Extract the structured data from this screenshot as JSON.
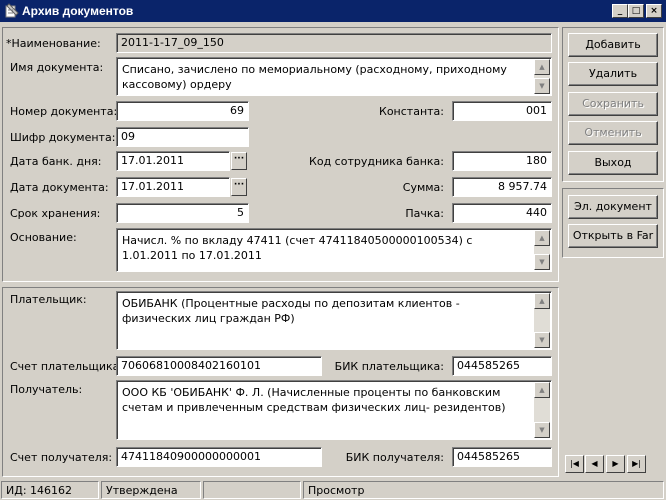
{
  "window": {
    "title": "Архив документов",
    "minimize": "_",
    "maximize": "□",
    "close": "×"
  },
  "document": {
    "name_label": "*Наименование:",
    "name_value": "2011-1-17_09_150",
    "docname_label": "Имя документа:",
    "docname_value": "Списано, зачислено по мемориальному (расходному, приходному кассовому) ордеру",
    "number_label": "Номер документа:",
    "number_value": "69",
    "constant_label": "Константа:",
    "constant_value": "001",
    "cipher_label": "Шифр документа:",
    "cipher_value": "09",
    "bankday_label": "Дата банк. дня:",
    "bankday_value": "17.01.2011",
    "employee_label": "Код сотрудника банка:",
    "employee_value": "180",
    "docdate_label": "Дата документа:",
    "docdate_value": "17.01.2011",
    "sum_label": "Сумма:",
    "sum_value": "8 957.74",
    "storage_label": "Срок хранения:",
    "storage_value": "5",
    "pack_label": "Пачка:",
    "pack_value": "440",
    "basis_label": "Основание:",
    "basis_value": "Начисл. % по вкладу 47411 (счет 47411840500000100534) с  1.01.2011 по 17.01.2011"
  },
  "parties": {
    "payer_label": "Плательщик:",
    "payer_value": "ОБИБАНК (Процентные расходы по депозитам клиентов - физических лиц граждан РФ)",
    "payer_account_label": "Счет плательщика:",
    "payer_account_value": "70606810008402160101",
    "payer_bik_label": "БИК плательщика:",
    "payer_bik_value": "044585265",
    "recipient_label": "Получатель:",
    "recipient_value": "ООО КБ 'ОБИБАНК' Ф. Л. (Начисленные проценты по банковским счетам и привлеченным средствам  физических лиц- резидентов)",
    "recipient_account_label": "Счет получателя:",
    "recipient_account_value": "47411840900000000001",
    "recipient_bik_label": "БИК получателя:",
    "recipient_bik_value": "044585265"
  },
  "actions": {
    "add": "Добавить",
    "delete": "Удалить",
    "save": "Сохранить",
    "cancel": "Отменить",
    "exit": "Выход",
    "edoc": "Эл. документ",
    "open_far": "Открыть в Far"
  },
  "nav": {
    "first": "|◀",
    "prev": "◀",
    "next": "▶",
    "last": "▶|"
  },
  "status": {
    "id": "ИД: 146162",
    "state": "Утверждена",
    "empty": "",
    "mode": "Просмотр"
  },
  "colors": {
    "titlebar": "#0a246a",
    "face": "#d4d0c8"
  }
}
